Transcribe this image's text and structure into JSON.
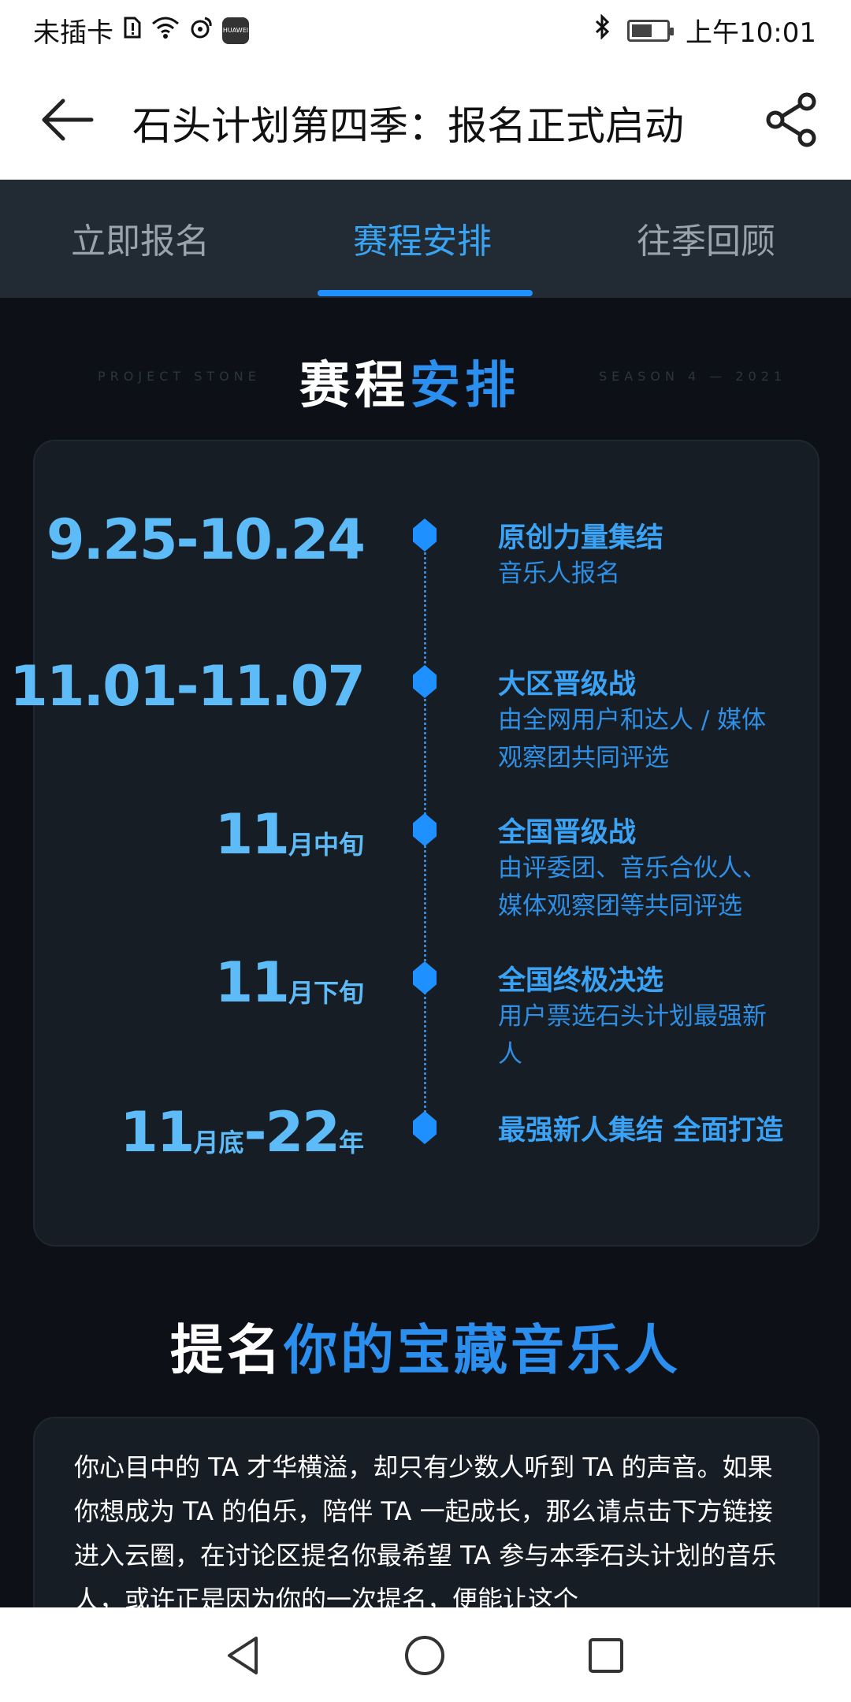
{
  "status_bar": {
    "carrier": "未插卡",
    "time": "上午10:01",
    "huawei_label": "HUAWEI",
    "battery_level": 0.6
  },
  "app_bar": {
    "title": "石头计划第四季：报名正式启动"
  },
  "tabs": [
    {
      "label": "立即报名",
      "active": false
    },
    {
      "label": "赛程安排",
      "active": true
    },
    {
      "label": "往季回顾",
      "active": false
    }
  ],
  "schedule": {
    "decor_left": "PROJECT STONE",
    "title_white": "赛程",
    "title_accent": "安排",
    "decor_right": "SEASON 4 — 2021",
    "items": [
      {
        "date": "9.25-10.24",
        "heading": "原创力量集结",
        "desc": "音乐人报名"
      },
      {
        "date": "11.01-11.07",
        "heading": "大区晋级战",
        "desc": "由全网用户和达人 / 媒体观察团共同评选"
      },
      {
        "date_num": "11",
        "date_suffix": "月中旬",
        "heading": "全国晋级战",
        "desc": "由评委团、音乐合伙人、媒体观察团等共同评选"
      },
      {
        "date_num": "11",
        "date_suffix": "月下旬",
        "heading": "全国终极决选",
        "desc": "用户票选石头计划最强新人"
      },
      {
        "date_num": "11",
        "date_mid": "月底",
        "date_num2": "-22",
        "date_suffix": "年",
        "heading": "最强新人集结 全面打造",
        "desc": ""
      }
    ]
  },
  "nominate": {
    "title_white": "提名",
    "title_accent": "你的宝藏音乐人",
    "text": "你心目中的 TA 才华横溢，却只有少数人听到 TA 的声音。如果你想成为 TA 的伯乐，陪伴 TA 一起成长，那么请点击下方链接进入云圈，在讨论区提名你最希望 TA 参与本季石头计划的音乐人，或许正是因为你的一次提名，便能让这个"
  },
  "colors": {
    "accent": "#1e90ff",
    "background": "#0d1117",
    "tab_bar": "#222a33",
    "card": "#171d25"
  },
  "icons": {
    "back": "arrow-left-icon",
    "share": "share-icon",
    "nav_back": "triangle-back-icon",
    "nav_home": "circle-home-icon",
    "nav_recent": "square-recent-icon"
  }
}
